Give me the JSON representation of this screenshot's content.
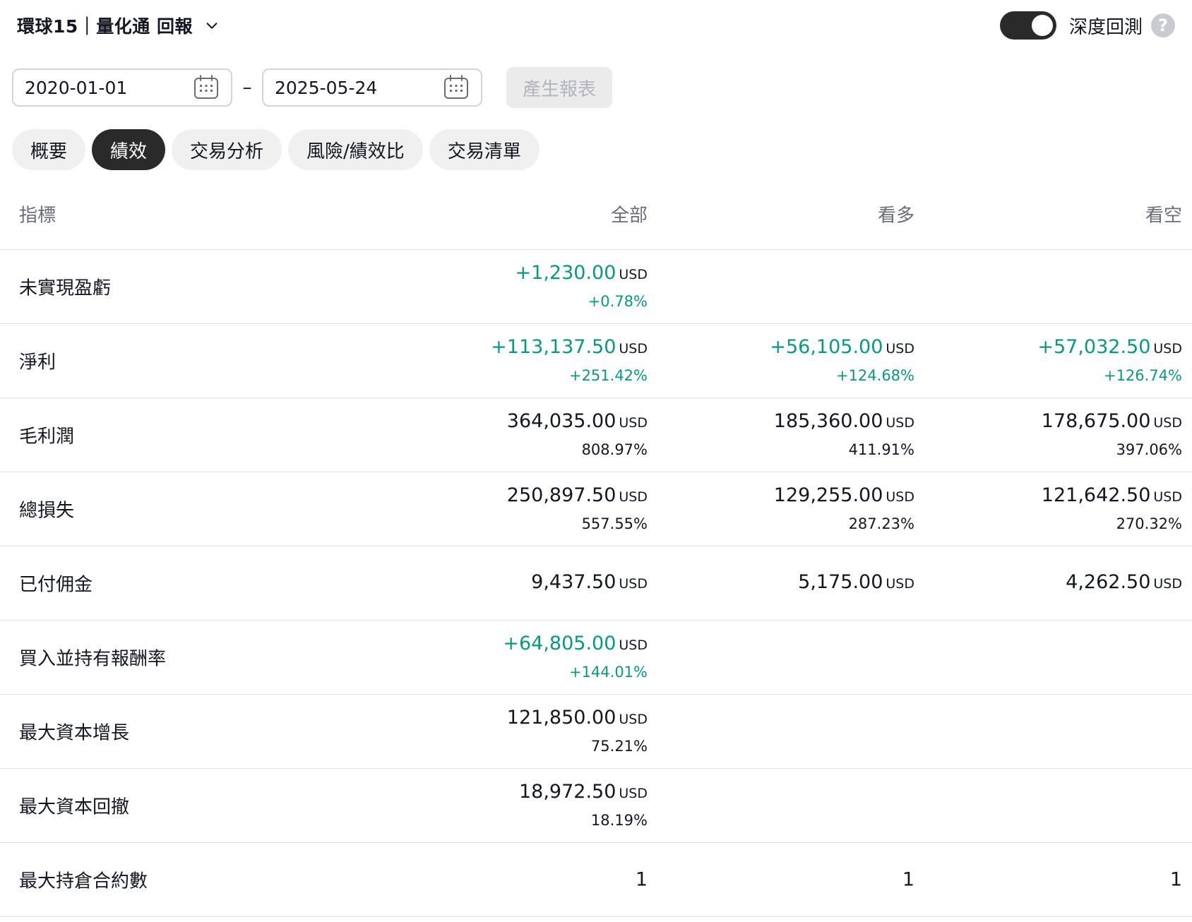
{
  "header": {
    "title": "環球15｜量化通 回報",
    "deep_backtest_label": "深度回測",
    "help_glyph": "?",
    "toggle_on": true
  },
  "date_range": {
    "start": "2020-01-01",
    "separator": "–",
    "end": "2025-05-24",
    "generate_label": "產生報表"
  },
  "tabs": [
    {
      "label": "概要",
      "active": false
    },
    {
      "label": "績效",
      "active": true
    },
    {
      "label": "交易分析",
      "active": false
    },
    {
      "label": "風險/績效比",
      "active": false
    },
    {
      "label": "交易清單",
      "active": false
    }
  ],
  "table": {
    "headers": {
      "metric": "指標",
      "all": "全部",
      "long": "看多",
      "short": "看空"
    },
    "unit": "USD",
    "rows": [
      {
        "name": "未實現盈虧",
        "all": {
          "amount": "+1,230.00",
          "pct": "+0.78%",
          "positive": true
        },
        "long": null,
        "short": null
      },
      {
        "name": "淨利",
        "all": {
          "amount": "+113,137.50",
          "pct": "+251.42%",
          "positive": true
        },
        "long": {
          "amount": "+56,105.00",
          "pct": "+124.68%",
          "positive": true
        },
        "short": {
          "amount": "+57,032.50",
          "pct": "+126.74%",
          "positive": true
        }
      },
      {
        "name": "毛利潤",
        "all": {
          "amount": "364,035.00",
          "pct": "808.97%",
          "positive": false
        },
        "long": {
          "amount": "185,360.00",
          "pct": "411.91%",
          "positive": false
        },
        "short": {
          "amount": "178,675.00",
          "pct": "397.06%",
          "positive": false
        }
      },
      {
        "name": "總損失",
        "all": {
          "amount": "250,897.50",
          "pct": "557.55%",
          "positive": false
        },
        "long": {
          "amount": "129,255.00",
          "pct": "287.23%",
          "positive": false
        },
        "short": {
          "amount": "121,642.50",
          "pct": "270.32%",
          "positive": false
        }
      },
      {
        "name": "已付佣金",
        "all": {
          "amount": "9,437.50",
          "pct": null,
          "positive": false
        },
        "long": {
          "amount": "5,175.00",
          "pct": null,
          "positive": false
        },
        "short": {
          "amount": "4,262.50",
          "pct": null,
          "positive": false
        }
      },
      {
        "name": "買入並持有報酬率",
        "all": {
          "amount": "+64,805.00",
          "pct": "+144.01%",
          "positive": true
        },
        "long": null,
        "short": null
      },
      {
        "name": "最大資本增長",
        "all": {
          "amount": "121,850.00",
          "pct": "75.21%",
          "positive": false
        },
        "long": null,
        "short": null
      },
      {
        "name": "最大資本回撤",
        "all": {
          "amount": "18,972.50",
          "pct": "18.19%",
          "positive": false
        },
        "long": null,
        "short": null
      },
      {
        "name": "最大持倉合約數",
        "all": {
          "plain": "1"
        },
        "long": {
          "plain": "1"
        },
        "short": {
          "plain": "1"
        }
      }
    ]
  },
  "colors": {
    "positive": "#089981",
    "text": "#131722",
    "muted": "#6a6d78",
    "dark_pill": "#2a2a2a"
  }
}
